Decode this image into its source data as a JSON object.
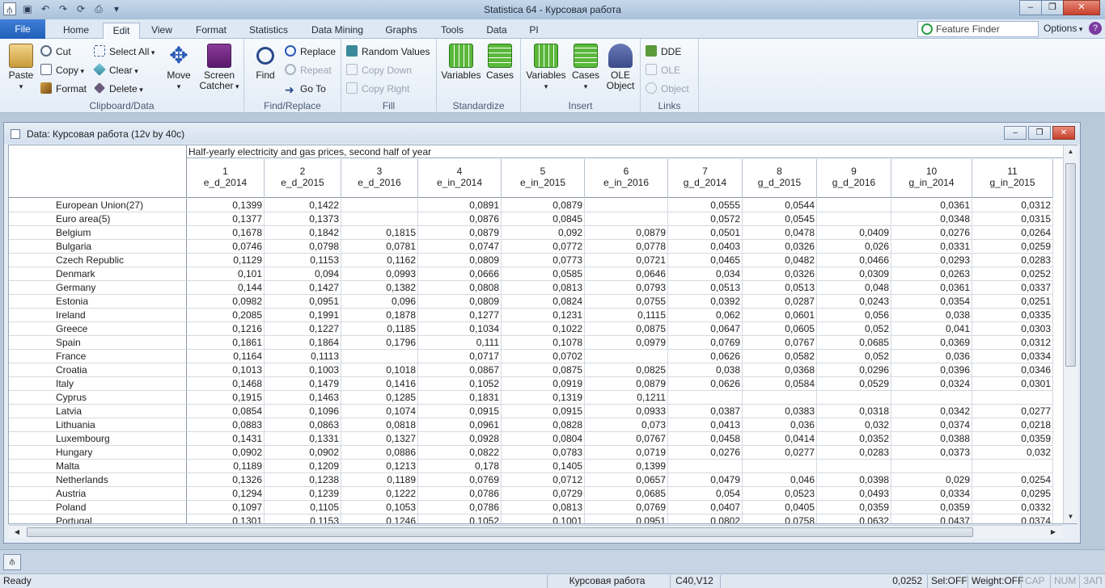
{
  "window": {
    "title": "Statistica 64 - Курсовая работа",
    "qat_icons": [
      "statistica-icon",
      "save-icon",
      "undo-icon",
      "redo-icon",
      "redo-more-icon",
      "print-icon",
      "customize-icon"
    ]
  },
  "tabs": [
    "File",
    "Home",
    "Edit",
    "View",
    "Format",
    "Statistics",
    "Data Mining",
    "Graphs",
    "Tools",
    "Data",
    "PI"
  ],
  "active_tab": "Edit",
  "feature_finder": {
    "placeholder": "Feature Finder"
  },
  "options_label": "Options",
  "ribbon": {
    "clipboard": {
      "label": "Clipboard/Data",
      "paste": "Paste",
      "cut": "Cut",
      "copy": "Copy",
      "format": "Format",
      "select_all": "Select All",
      "clear": "Clear",
      "delete": "Delete",
      "move": "Move",
      "screen_catcher_1": "Screen",
      "screen_catcher_2": "Catcher"
    },
    "find_replace": {
      "label": "Find/Replace",
      "find": "Find",
      "replace": "Replace",
      "repeat": "Repeat",
      "goto": "Go To"
    },
    "fill": {
      "label": "Fill",
      "random_values": "Random Values",
      "copy_down": "Copy Down",
      "copy_right": "Copy Right"
    },
    "standardize": {
      "label": "Standardize",
      "variables": "Variables",
      "cases": "Cases"
    },
    "insert": {
      "label": "Insert",
      "variables": "Variables",
      "cases": "Cases",
      "ole_object_1": "OLE",
      "ole_object_2": "Object"
    },
    "links": {
      "label": "Links",
      "dde": "DDE",
      "ole": "OLE",
      "object": "Object"
    }
  },
  "sheet": {
    "window_title": "Data: Курсовая работа (12v by 40c)",
    "header_title": "Half-yearly electricity and gas prices, second half of year",
    "columns": [
      {
        "num": "1",
        "name": "e_d_2014"
      },
      {
        "num": "2",
        "name": "e_d_2015"
      },
      {
        "num": "3",
        "name": "e_d_2016"
      },
      {
        "num": "4",
        "name": "e_in_2014"
      },
      {
        "num": "5",
        "name": "e_in_2015"
      },
      {
        "num": "6",
        "name": "e_in_2016"
      },
      {
        "num": "7",
        "name": "g_d_2014"
      },
      {
        "num": "8",
        "name": "g_d_2015"
      },
      {
        "num": "9",
        "name": "g_d_2016"
      },
      {
        "num": "10",
        "name": "g_in_2014"
      },
      {
        "num": "11",
        "name": "g_in_2015"
      }
    ],
    "rows": [
      {
        "label": "European Union(27)",
        "values": [
          "0,1399",
          "0,1422",
          "",
          "0,0891",
          "0,0879",
          "",
          "0,0555",
          "0,0544",
          "",
          "0,0361",
          "0,0312"
        ]
      },
      {
        "label": "Euro area(5)",
        "values": [
          "0,1377",
          "0,1373",
          "",
          "0,0876",
          "0,0845",
          "",
          "0,0572",
          "0,0545",
          "",
          "0,0348",
          "0,0315"
        ]
      },
      {
        "label": "Belgium",
        "values": [
          "0,1678",
          "0,1842",
          "0,1815",
          "0,0879",
          "0,092",
          "0,0879",
          "0,0501",
          "0,0478",
          "0,0409",
          "0,0276",
          "0,0264"
        ]
      },
      {
        "label": "Bulgaria",
        "values": [
          "0,0746",
          "0,0798",
          "0,0781",
          "0,0747",
          "0,0772",
          "0,0778",
          "0,0403",
          "0,0326",
          "0,026",
          "0,0331",
          "0,0259"
        ]
      },
      {
        "label": "Czech Republic",
        "values": [
          "0,1129",
          "0,1153",
          "0,1162",
          "0,0809",
          "0,0773",
          "0,0721",
          "0,0465",
          "0,0482",
          "0,0466",
          "0,0293",
          "0,0283"
        ]
      },
      {
        "label": "Denmark",
        "values": [
          "0,101",
          "0,094",
          "0,0993",
          "0,0666",
          "0,0585",
          "0,0646",
          "0,034",
          "0,0326",
          "0,0309",
          "0,0263",
          "0,0252"
        ]
      },
      {
        "label": "Germany",
        "values": [
          "0,144",
          "0,1427",
          "0,1382",
          "0,0808",
          "0,0813",
          "0,0793",
          "0,0513",
          "0,0513",
          "0,048",
          "0,0361",
          "0,0337"
        ]
      },
      {
        "label": "Estonia",
        "values": [
          "0,0982",
          "0,0951",
          "0,096",
          "0,0809",
          "0,0824",
          "0,0755",
          "0,0392",
          "0,0287",
          "0,0243",
          "0,0354",
          "0,0251"
        ]
      },
      {
        "label": "Ireland",
        "values": [
          "0,2085",
          "0,1991",
          "0,1878",
          "0,1277",
          "0,1231",
          "0,1115",
          "0,062",
          "0,0601",
          "0,056",
          "0,038",
          "0,0335"
        ]
      },
      {
        "label": "Greece",
        "values": [
          "0,1216",
          "0,1227",
          "0,1185",
          "0,1034",
          "0,1022",
          "0,0875",
          "0,0647",
          "0,0605",
          "0,052",
          "0,041",
          "0,0303"
        ]
      },
      {
        "label": "Spain",
        "values": [
          "0,1861",
          "0,1864",
          "0,1796",
          "0,111",
          "0,1078",
          "0,0979",
          "0,0769",
          "0,0767",
          "0,0685",
          "0,0369",
          "0,0312"
        ]
      },
      {
        "label": "France",
        "values": [
          "0,1164",
          "0,1113",
          "",
          "0,0717",
          "0,0702",
          "",
          "0,0626",
          "0,0582",
          "0,052",
          "0,036",
          "0,0334"
        ]
      },
      {
        "label": "Croatia",
        "values": [
          "0,1013",
          "0,1003",
          "0,1018",
          "0,0867",
          "0,0875",
          "0,0825",
          "0,038",
          "0,0368",
          "0,0296",
          "0,0396",
          "0,0346"
        ]
      },
      {
        "label": "Italy",
        "values": [
          "0,1468",
          "0,1479",
          "0,1416",
          "0,1052",
          "0,0919",
          "0,0879",
          "0,0626",
          "0,0584",
          "0,0529",
          "0,0324",
          "0,0301"
        ]
      },
      {
        "label": "Cyprus",
        "values": [
          "0,1915",
          "0,1463",
          "0,1285",
          "0,1831",
          "0,1319",
          "0,1211",
          "",
          "",
          "",
          "",
          ""
        ]
      },
      {
        "label": "Latvia",
        "values": [
          "0,0854",
          "0,1096",
          "0,1074",
          "0,0915",
          "0,0915",
          "0,0933",
          "0,0387",
          "0,0383",
          "0,0318",
          "0,0342",
          "0,0277"
        ]
      },
      {
        "label": "Lithuania",
        "values": [
          "0,0883",
          "0,0863",
          "0,0818",
          "0,0961",
          "0,0828",
          "0,073",
          "0,0413",
          "0,036",
          "0,032",
          "0,0374",
          "0,0218"
        ]
      },
      {
        "label": "Luxembourg",
        "values": [
          "0,1431",
          "0,1331",
          "0,1327",
          "0,0928",
          "0,0804",
          "0,0767",
          "0,0458",
          "0,0414",
          "0,0352",
          "0,0388",
          "0,0359"
        ]
      },
      {
        "label": "Hungary",
        "values": [
          "0,0902",
          "0,0902",
          "0,0886",
          "0,0822",
          "0,0783",
          "0,0719",
          "0,0276",
          "0,0277",
          "0,0283",
          "0,0373",
          "0,032"
        ]
      },
      {
        "label": "Malta",
        "values": [
          "0,1189",
          "0,1209",
          "0,1213",
          "0,178",
          "0,1405",
          "0,1399",
          "",
          "",
          "",
          "",
          ""
        ]
      },
      {
        "label": "Netherlands",
        "values": [
          "0,1326",
          "0,1238",
          "0,1189",
          "0,0769",
          "0,0712",
          "0,0657",
          "0,0479",
          "0,046",
          "0,0398",
          "0,029",
          "0,0254"
        ]
      },
      {
        "label": "Austria",
        "values": [
          "0,1294",
          "0,1239",
          "0,1222",
          "0,0786",
          "0,0729",
          "0,0685",
          "0,054",
          "0,0523",
          "0,0493",
          "0,0334",
          "0,0295"
        ]
      },
      {
        "label": "Poland",
        "values": [
          "0,1097",
          "0,1105",
          "0,1053",
          "0,0786",
          "0,0813",
          "0,0769",
          "0,0407",
          "0,0405",
          "0,0359",
          "0,0359",
          "0,0332"
        ]
      },
      {
        "label": "Portugal",
        "values": [
          "0,1301",
          "0,1153",
          "0,1246",
          "0,1052",
          "0,1001",
          "0,0951",
          "0,0802",
          "0,0758",
          "0,0632",
          "0,0437",
          "0,0374"
        ]
      }
    ]
  },
  "statusbar": {
    "ready": "Ready",
    "doc": "Курсовая работа",
    "cell": "C40,V12",
    "value": "0,0252",
    "sel": "Sel:OFF",
    "weight": "Weight:OFF",
    "cap": "CAP",
    "num": "NUM",
    "zap": "ЗАП"
  }
}
